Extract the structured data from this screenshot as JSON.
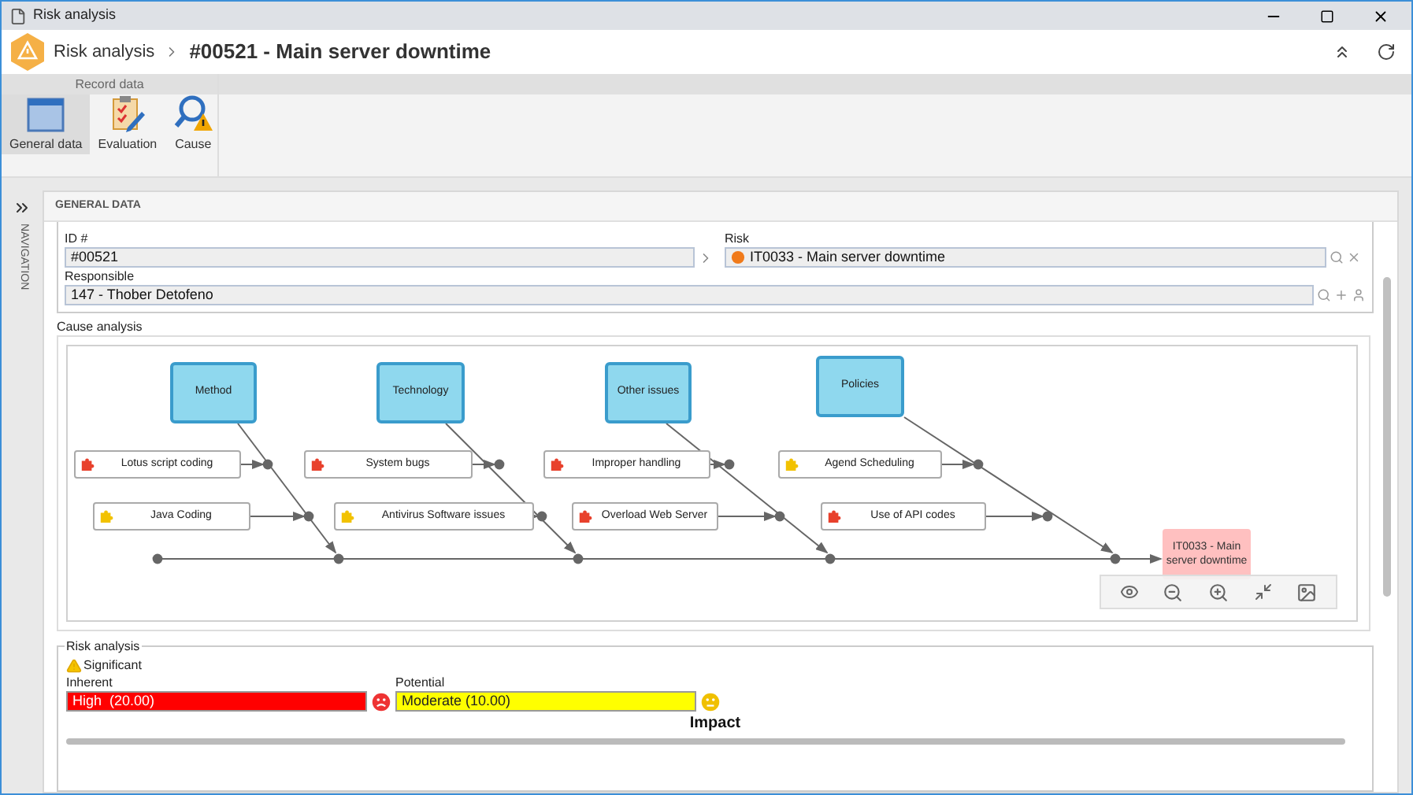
{
  "window": {
    "title": "Risk analysis"
  },
  "breadcrumb": {
    "parent": "Risk analysis",
    "current": "#00521 - Main server downtime"
  },
  "ribbon": {
    "group": "Record data",
    "buttons": [
      {
        "label": "General data",
        "selected": true
      },
      {
        "label": "Evaluation",
        "selected": false
      },
      {
        "label": "Cause",
        "selected": false
      }
    ]
  },
  "navigation": {
    "label": "NAVIGATION"
  },
  "section": {
    "title": "GENERAL DATA"
  },
  "fields": [
    {
      "label": "ID #",
      "value": "#00521"
    },
    {
      "label": "Risk",
      "value": "IT0033 - Main server downtime"
    },
    {
      "label": "Responsible",
      "value": "147 - Thober Detofeno"
    }
  ],
  "cause_analysis": {
    "label": "Cause analysis",
    "effect": "IT0033 - Main server downtime",
    "categories": [
      {
        "name": "Method",
        "causes": [
          {
            "name": "Lotus script coding",
            "color": "#e8412c"
          },
          {
            "name": "Java Coding",
            "color": "#f2c200"
          }
        ]
      },
      {
        "name": "Technology",
        "causes": [
          {
            "name": "System bugs",
            "color": "#e8412c"
          },
          {
            "name": "Antivirus Software issues",
            "color": "#f2c200"
          }
        ]
      },
      {
        "name": "Other issues",
        "causes": [
          {
            "name": "Improper handling",
            "color": "#e8412c"
          },
          {
            "name": "Overload Web Server",
            "color": "#e8412c"
          }
        ]
      },
      {
        "name": "Policies",
        "causes": [
          {
            "name": "Agend Scheduling",
            "color": "#f2c200"
          },
          {
            "name": "Use of API codes",
            "color": "#e8412c"
          }
        ]
      }
    ]
  },
  "risk_analysis": {
    "label": "Risk analysis",
    "level": "Significant",
    "ratings": [
      {
        "label": "Inherent",
        "value": "High  (20.00)",
        "color": "#ff0000",
        "kind": "sad"
      },
      {
        "label": "Potential",
        "value": "Moderate (10.00)",
        "color": "#ffff00",
        "kind": "neutral"
      }
    ],
    "impact": "Impact"
  }
}
